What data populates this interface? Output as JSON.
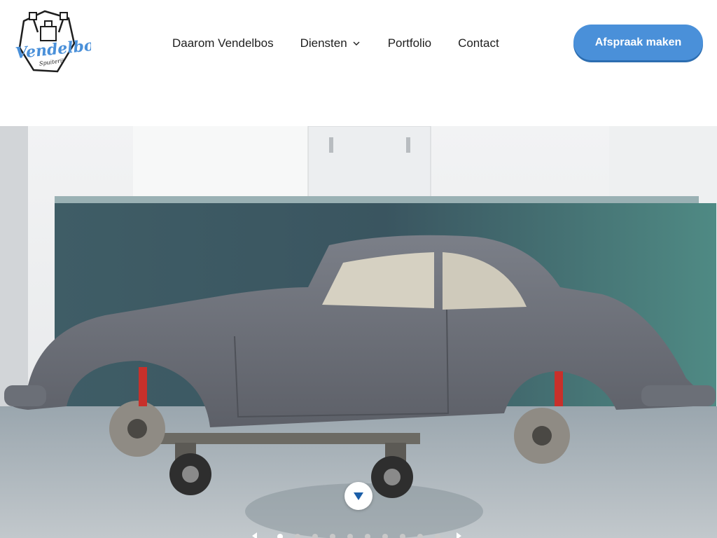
{
  "brand": {
    "logo_text": "Vendelbos",
    "logo_subtext": "Spuiterij",
    "accent_color": "#4a90d9"
  },
  "nav": {
    "items": [
      {
        "label": "Daarom Vendelbos"
      },
      {
        "label": "Diensten",
        "has_dropdown": true,
        "icon": "chevron-down-icon"
      },
      {
        "label": "Portfolio"
      },
      {
        "label": "Contact"
      }
    ]
  },
  "cta": {
    "label": "Afspraak maken",
    "color": "#4a90d9"
  },
  "hero": {
    "image_subject": "car-body-on-dolly-in-spray-booth",
    "scroll_icon": "triangle-down-icon",
    "slider": {
      "slide_count": 10,
      "active_index": 0
    }
  }
}
